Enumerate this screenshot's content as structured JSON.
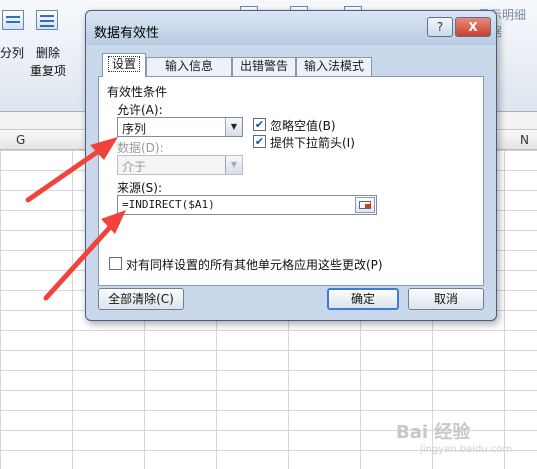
{
  "ribbon": {
    "items": [
      "分列",
      "删除",
      "重复项"
    ],
    "partial_label": "显示明细数据"
  },
  "columns": {
    "g": "G",
    "n": "N"
  },
  "dialog": {
    "title": "数据有效性",
    "help": "?",
    "close": "X",
    "tabs": [
      "设置",
      "输入信息",
      "出错警告",
      "输入法模式"
    ],
    "section_title": "有效性条件",
    "allow_label": "允许(A):",
    "allow_value": "序列",
    "data_label": "数据(D):",
    "data_value": "介于",
    "ignore_blank_label": "忽略空值(B)",
    "ignore_blank_checked": true,
    "dropdown_label": "提供下拉箭头(I)",
    "dropdown_checked": true,
    "source_label": "来源(S):",
    "source_value": "=INDIRECT($A1)",
    "apply_all_label": "对有同样设置的所有其他单元格应用这些更改(P)",
    "apply_all_checked": false,
    "clear_all_button": "全部清除(C)",
    "ok_button": "确定",
    "cancel_button": "取消"
  },
  "watermark": {
    "text": "Bai 经验",
    "sub": "jingyan.baidu.com"
  },
  "colors": {
    "annotation_arrow": "#f0433c",
    "dialog_bg": "#c9d7ea",
    "default_button_border": "#3d7bd6"
  }
}
